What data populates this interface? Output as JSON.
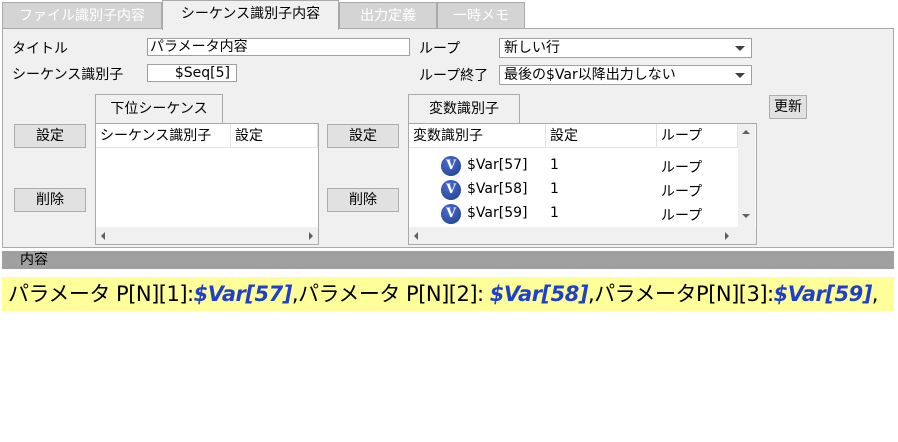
{
  "tabs": [
    {
      "label": "ファイル識別子内容",
      "active": false
    },
    {
      "label": "シーケンス識別子内容",
      "active": true
    },
    {
      "label": "出力定義",
      "active": false
    },
    {
      "label": "一時メモ",
      "active": false
    }
  ],
  "form": {
    "title_label": "タイトル",
    "title_value": "パラメータ内容",
    "seq_id_label": "シーケンス識別子",
    "seq_id_value": "$Seq[5]",
    "loop_label": "ループ",
    "loop_value": "新しい行",
    "loop_end_label": "ループ終了",
    "loop_end_value": "最後の$Var以降出力しない",
    "update_button": "更新"
  },
  "sub_sequence": {
    "tab_label": "下位シーケンス",
    "set_button": "設定",
    "delete_button": "削除",
    "columns": [
      "シーケンス識別子",
      "設定"
    ],
    "rows": []
  },
  "variables": {
    "tab_label": "変数識別子",
    "set_button": "設定",
    "delete_button": "削除",
    "columns": [
      "変数識別子",
      "設定",
      "ループ"
    ],
    "rows": [
      {
        "icon": "V",
        "name": "$Var[57]",
        "setting": "1",
        "loop": "ループ"
      },
      {
        "icon": "V",
        "name": "$Var[58]",
        "setting": "1",
        "loop": "ループ"
      },
      {
        "icon": "V",
        "name": "$Var[59]",
        "setting": "1",
        "loop": "ループ"
      }
    ]
  },
  "content": {
    "header": "内容",
    "segments": [
      {
        "text": "パラメータ P[N][1]:",
        "var": false
      },
      {
        "text": "$Var[57]",
        "var": true
      },
      {
        "text": ",パラメータ P[N][2]: ",
        "var": false
      },
      {
        "text": "$Var[58]",
        "var": true
      },
      {
        "text": ",パラメータP[N][3]:",
        "var": false
      },
      {
        "text": "$Var[59]",
        "var": true
      },
      {
        "text": ",",
        "var": false
      }
    ]
  },
  "colors": {
    "highlight": "#ffff99",
    "variable_text": "#1f3fcc",
    "inactive_tab": "#d4d4d4",
    "content_header": "#a0a0a0"
  }
}
